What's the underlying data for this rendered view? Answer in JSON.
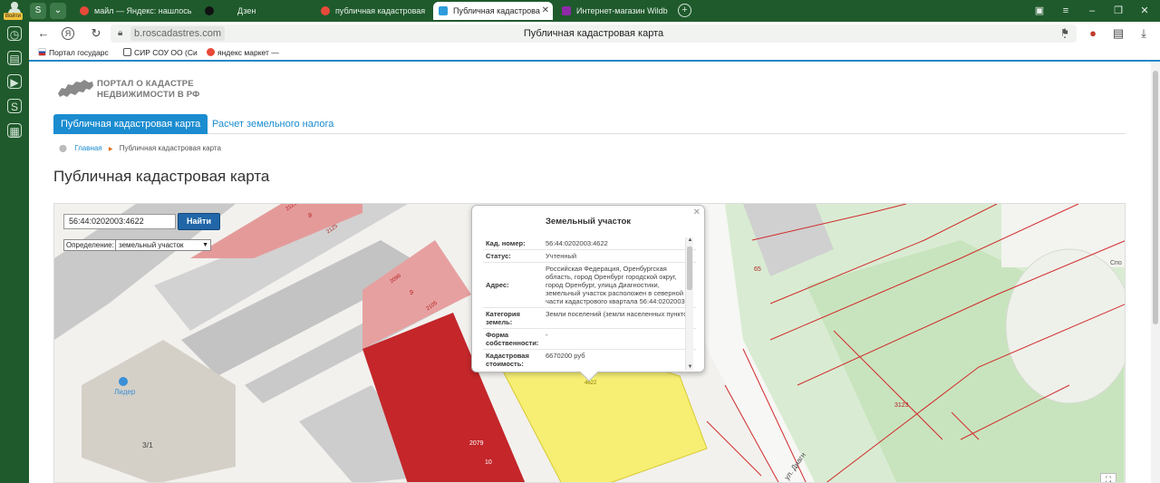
{
  "sidebar": {
    "login_label": "Войти",
    "icons": [
      "history-icon",
      "notes-icon",
      "video-icon",
      "s-app-icon",
      "collections-icon"
    ]
  },
  "tabs": [
    {
      "label": "майл — Яндекс: нашлось",
      "active": false
    },
    {
      "label": "Дзен",
      "active": false
    },
    {
      "label": "публичная кадастровая к",
      "active": false
    },
    {
      "label": "Публичная кадастрова",
      "active": true
    },
    {
      "label": "Интернет-магазин Wildb",
      "active": false
    }
  ],
  "address_bar": {
    "url": "b.roscadastres.com",
    "page_title": "Публичная кадастровая карта"
  },
  "bookmarks": [
    {
      "label": "Портал государс"
    },
    {
      "label": "СИР СОУ ОО (Си"
    },
    {
      "label": "яндекс маркет —"
    }
  ],
  "site": {
    "logo_line1": "ПОРТАЛ О КАДАСТРЕ",
    "logo_line2": "НЕДВИЖИМОСТИ В РФ",
    "nav_active": "Публичная кадастровая карта",
    "nav_link": "Расчет земельного налога",
    "breadcrumb_home": "Главная",
    "breadcrumb_current": "Публичная кадастровая карта",
    "heading": "Публичная кадастровая карта"
  },
  "map": {
    "search_value": "56:44:0202003:4622",
    "search_button": "Найти",
    "definition_label": "Определение:",
    "definition_value": "земельный участок",
    "labels": {
      "lider": "Лидер",
      "house": "3/1",
      "street": "ул. Диагн",
      "corner": "Спо",
      "n65": "65",
      "n3123": "3123",
      "n2079": "2079",
      "n10": "10",
      "n4622": "4622",
      "n9a": "9",
      "n9b": "9",
      "n2125": "2125",
      "n2096": "2096",
      "n2105": "2105",
      "n2123": "2123"
    }
  },
  "popup": {
    "title": "Земельный участок",
    "rows": [
      {
        "key": "Кад. номер:",
        "value": "56:44:0202003:4622"
      },
      {
        "key": "Статус:",
        "value": "Учтенный"
      },
      {
        "key": "Адрес:",
        "value": "Российская Федерация, Оренбургская область, город Оренбург городской округ, город Оренбург, улица Диагностики, земельный участок расположен в северной части кадастрового квартала 56:44:0202003"
      },
      {
        "key": "Категория земель:",
        "value": "Земли поселений (земли населенных пунктов)"
      },
      {
        "key": "Форма собственности:",
        "value": "-"
      },
      {
        "key": "Кадастровая стоимость:",
        "value": "6670200 руб"
      }
    ]
  }
}
